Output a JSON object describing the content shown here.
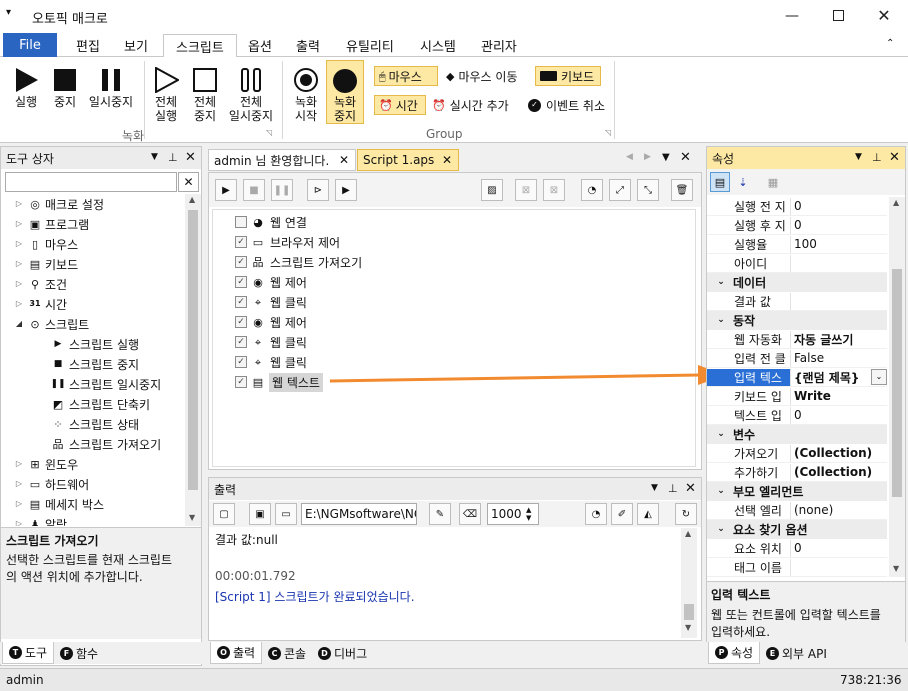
{
  "app": {
    "title": "오토픽 매크로"
  },
  "ribbon": {
    "tabs": [
      "File",
      "편집",
      "보기",
      "스크립트",
      "옵션",
      "출력",
      "유틸리티",
      "시스템",
      "관리자"
    ],
    "active_tab": "스크립트",
    "group1": {
      "label": "녹화",
      "run": "실행",
      "stop": "중지",
      "pause": "일시중지",
      "run_all_1": "전체",
      "run_all_2": "실행",
      "stop_all_1": "전체",
      "stop_all_2": "중지",
      "pause_all_1": "전체",
      "pause_all_2": "일시중지"
    },
    "group2": {
      "label": "Group",
      "rec_start_1": "녹화",
      "rec_start_2": "시작",
      "rec_stop_1": "녹화",
      "rec_stop_2": "중지",
      "mouse": "마우스",
      "mouse_move": "마우스 이동",
      "keyboard": "키보드",
      "time": "시간",
      "realtime_add": "실시간 추가",
      "event_cancel": "이벤트 취소"
    }
  },
  "toolbox": {
    "title": "도구 상자",
    "items": [
      "매크로 설정",
      "프로그램",
      "마우스",
      "키보드",
      "조건",
      "시간",
      "스크립트",
      "스크립트 실행",
      "스크립트 중지",
      "스크립트 일시중지",
      "스크립트 단축키",
      "스크립트 상태",
      "스크립트 가져오기",
      "윈도우",
      "하드웨어",
      "메세지 박스",
      "알람"
    ],
    "desc_title": "스크립트 가져오기",
    "desc_text_1": "선택한 스크립트를 현재 스크립트",
    "desc_text_2": "의 액션 위치에 추가합니다.",
    "tab_tools": "도구",
    "tab_functions": "함수",
    "tab_tools_badge": "T",
    "tab_functions_badge": "F"
  },
  "doc_tabs": [
    "admin 님 환영합니다.",
    "Script 1.aps"
  ],
  "script": {
    "actions": [
      "웹 연결",
      "브라우저 제어",
      "스크립트 가져오기",
      "웹 제어",
      "웹 클릭",
      "웹 제어",
      "웹 클릭",
      "웹 클릭",
      "웹 텍스트"
    ]
  },
  "output": {
    "title": "출력",
    "path": "E:\\NGMsoftware\\NG",
    "delay": "1000",
    "line1": "결과 값:null",
    "line2": "00:00:01.792",
    "line3": "[Script 1] 스크립트가 완료되었습니다.",
    "tabs": [
      "출력",
      "콘솔",
      "디버그"
    ],
    "tab_badges": [
      "O",
      "C",
      "D"
    ]
  },
  "properties": {
    "title": "속성",
    "rows": [
      {
        "k": "실행 전 지",
        "v": "0",
        "type": "row"
      },
      {
        "k": "실행 후 지",
        "v": "0",
        "type": "row"
      },
      {
        "k": "실행율",
        "v": "100",
        "type": "row"
      },
      {
        "k": "아이디",
        "v": "",
        "type": "row"
      },
      {
        "k": "데이터",
        "v": "",
        "type": "cat"
      },
      {
        "k": "결과 값",
        "v": "",
        "type": "row"
      },
      {
        "k": "동작",
        "v": "",
        "type": "cat"
      },
      {
        "k": "웹 자동화",
        "v": "자동 글쓰기",
        "type": "bold"
      },
      {
        "k": "입력 전 클",
        "v": "False",
        "type": "row"
      },
      {
        "k": "입력 텍스",
        "v": "{랜덤 제목}",
        "type": "sel"
      },
      {
        "k": "키보드 입",
        "v": "Write",
        "type": "bold"
      },
      {
        "k": "텍스트 입",
        "v": "0",
        "type": "row"
      },
      {
        "k": "변수",
        "v": "",
        "type": "cat"
      },
      {
        "k": "가져오기",
        "v": "(Collection)",
        "type": "bold"
      },
      {
        "k": "추가하기",
        "v": "(Collection)",
        "type": "bold"
      },
      {
        "k": "부모 엘리먼트",
        "v": "",
        "type": "cat"
      },
      {
        "k": "선택 엘리",
        "v": "(none)",
        "type": "row"
      },
      {
        "k": "요소 찾기 옵션",
        "v": "",
        "type": "cat"
      },
      {
        "k": "요소 위치",
        "v": "0",
        "type": "row"
      },
      {
        "k": "태그 이름",
        "v": "",
        "type": "row"
      }
    ],
    "desc_title": "입력 텍스트",
    "desc_text_1": "웹 또는 컨트롤에 입력할 텍스트를",
    "desc_text_2": "입력하세요.",
    "tab_props": "속성",
    "tab_api": "외부 API",
    "tab_props_badge": "P",
    "tab_api_badge": "E"
  },
  "status": {
    "user": "admin",
    "time": "738:21:36"
  },
  "colors": {
    "accent": "#2b65c2",
    "arrow": "#f28a30",
    "selection": "#2a6fd6"
  }
}
